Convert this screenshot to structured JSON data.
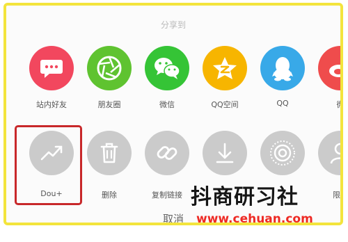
{
  "share_sheet": {
    "title": "分享到",
    "cancel_label": "取消",
    "share_targets": [
      {
        "label": "站内好友",
        "icon": "chat-bubble-icon",
        "color": "#f2475e"
      },
      {
        "label": "朋友圈",
        "icon": "camera-aperture-icon",
        "color": "#5fc330"
      },
      {
        "label": "微信",
        "icon": "wechat-icon",
        "color": "#35c436"
      },
      {
        "label": "QQ空间",
        "icon": "qzone-star-icon",
        "color": "#f7b500"
      },
      {
        "label": "QQ",
        "icon": "qq-penguin-icon",
        "color": "#38a9e8"
      },
      {
        "label": "微",
        "icon": "weibo-icon",
        "color": "#ef4c4c"
      }
    ],
    "actions": [
      {
        "label": "Dou+",
        "icon": "trend-arrow-icon"
      },
      {
        "label": "删除",
        "icon": "trash-icon"
      },
      {
        "label": "复制链接",
        "icon": "link-icon"
      },
      {
        "label": "",
        "icon": "download-icon"
      },
      {
        "label": "",
        "icon": "live-photo-icon"
      },
      {
        "label": "限流",
        "icon": "user-icon"
      }
    ]
  },
  "watermark": {
    "site_name": "抖商研习社",
    "url": "www.cehuan.com"
  },
  "colors": {
    "frame_border": "#f3e43c",
    "highlight_border": "#c8282a",
    "action_circle": "#cbcbcb"
  }
}
